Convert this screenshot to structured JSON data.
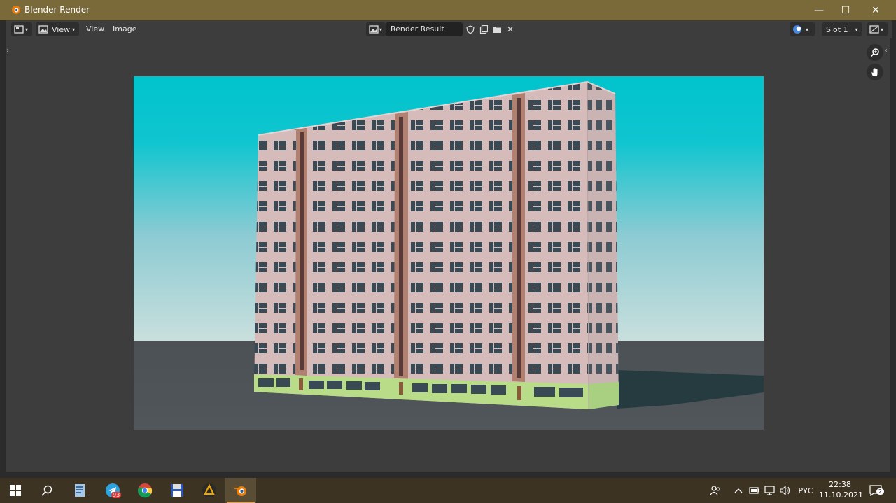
{
  "window": {
    "title": "Blender Render",
    "minimize": "—",
    "maximize": "☐",
    "close": "✕"
  },
  "header": {
    "view_dropdown": "View",
    "menus": [
      "View",
      "Image"
    ],
    "image_name": "Render Result",
    "slot": "Slot 1"
  },
  "taskbar": {
    "telegram_badge": "93",
    "language": "РУС",
    "time": "22:38",
    "date": "11.10.2021",
    "notifications": "2"
  },
  "colors": {
    "titlebar": "#7a6a3a",
    "taskbar": "#3d3323",
    "sky_top": "#00c4cc",
    "sky_bottom": "#c7dedd",
    "ground": "#4c5256",
    "facade": "#d5bcbb",
    "stair_column": "#b08070",
    "ground_floor": "#b9dc88",
    "window": "#3a4a55"
  }
}
